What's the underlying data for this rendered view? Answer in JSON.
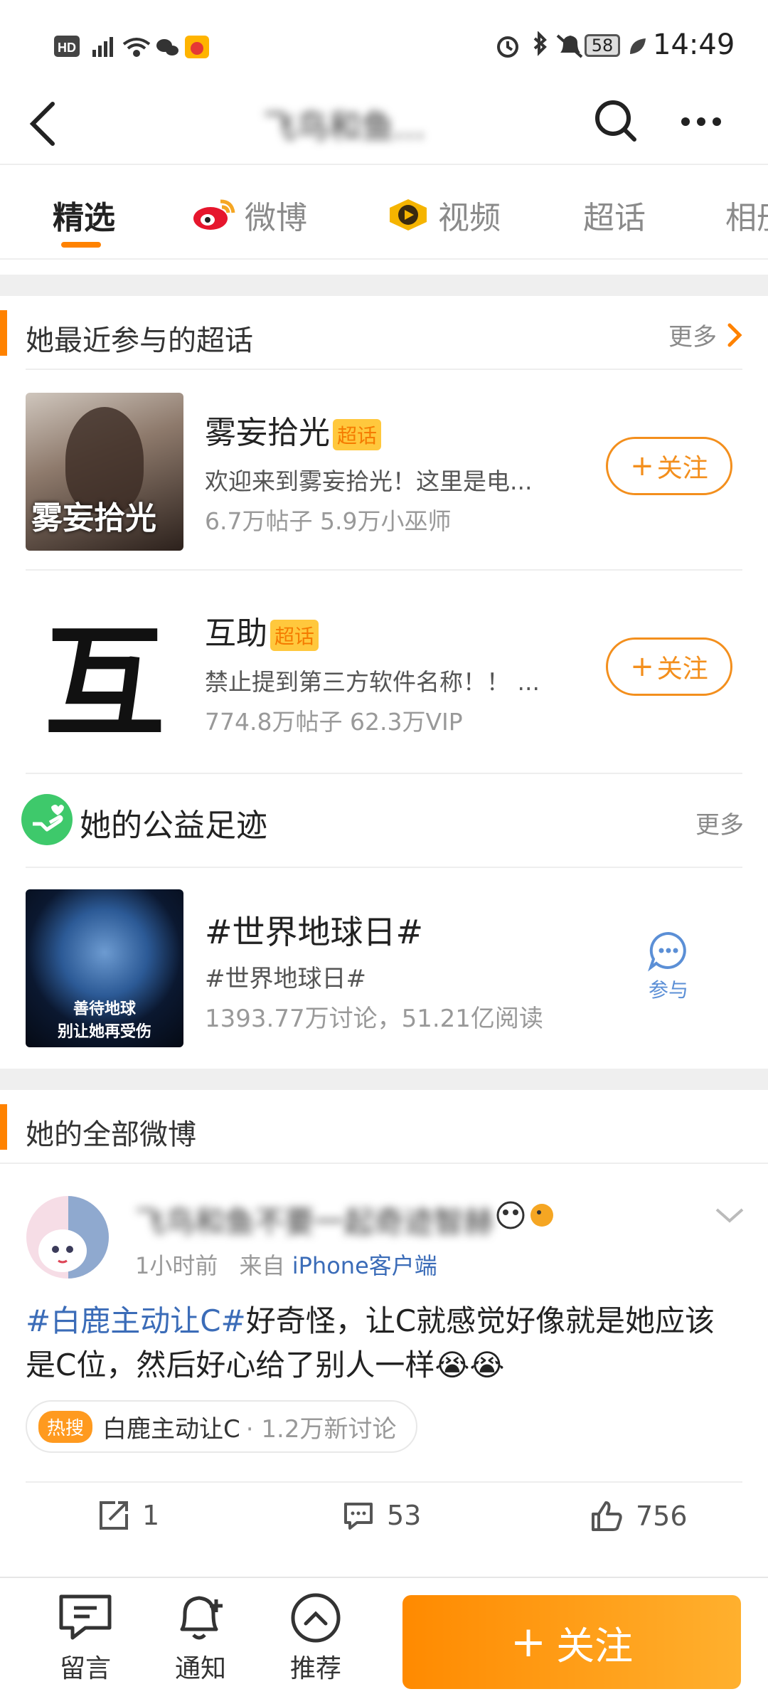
{
  "status_bar": {
    "left_icons": [
      "hd-icon",
      "signal-4g-icon",
      "wifi-icon",
      "wechat-icon",
      "app-notification-icon"
    ],
    "right_icons": [
      "alarm-icon",
      "bluetooth-icon",
      "mute-icon"
    ],
    "battery": "58",
    "time": "14:49"
  },
  "app_bar": {
    "title": "飞鸟和鱼..."
  },
  "tabs": [
    {
      "label": "精选",
      "active": true
    },
    {
      "label": "微博",
      "active": false
    },
    {
      "label": "视频",
      "active": false
    },
    {
      "label": "超话",
      "active": false
    },
    {
      "label": "相册",
      "active": false
    }
  ],
  "supertopics": {
    "title": "她最近参与的超话",
    "more": "更多",
    "items": [
      {
        "name": "雾妄拾光",
        "badge": "超话",
        "desc": "欢迎来到雾妄拾光！这里是电...",
        "stats": "6.7万帖子 5.9万小巫师",
        "follow": "关注",
        "thumb_text": "雾妄拾光"
      },
      {
        "name": "互助",
        "badge": "超话",
        "desc": "禁止提到第三方软件名称！！ ...",
        "stats": "774.8万帖子 62.3万VIP",
        "follow": "关注",
        "thumb_text": "互"
      }
    ]
  },
  "charity": {
    "title": "她的公益足迹",
    "more": "更多",
    "item": {
      "title": "#世界地球日#",
      "subtitle": "#世界地球日#",
      "stats": "1393.77万讨论，51.21亿阅读",
      "thumb_line1": "善待地球",
      "thumb_line2": "别让她再受伤",
      "action": "参与"
    }
  },
  "weibo": {
    "section_title": "她的全部微博",
    "post": {
      "author": "飞鸟和鱼不要一起奇迹智赫",
      "time": "1小时前",
      "source_prefix": "来自",
      "source": "iPhone客户端",
      "hashtag": "#白鹿主动让C#",
      "text": "好奇怪，让C就感觉好像就是她应该是C位，然后好心给了别人一样",
      "emoji": "😭😭",
      "hot_label": "热搜",
      "hot_topic": "白鹿主动让C",
      "hot_stats": "· 1.2万新讨论",
      "reposts": "1",
      "comments": "53",
      "likes": "756"
    }
  },
  "bottom_bar": {
    "items": [
      {
        "label": "留言"
      },
      {
        "label": "通知"
      },
      {
        "label": "推荐"
      }
    ],
    "follow": "关注"
  },
  "colors": {
    "accent": "#ff8200",
    "link": "#3b6cb8",
    "divider": "#eeeeee"
  }
}
